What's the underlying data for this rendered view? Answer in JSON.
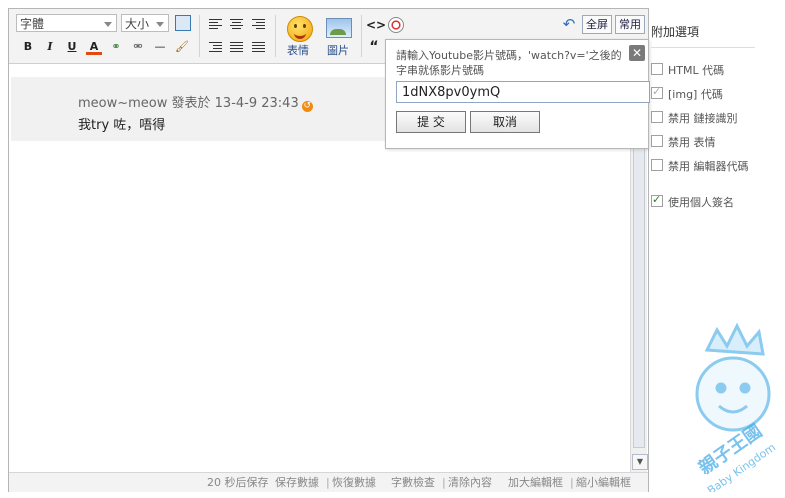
{
  "toolbar": {
    "font_select": "字體",
    "size_select": "大小",
    "emoticon_label": "表情",
    "image_label": "圖片",
    "fullscreen": "全屏",
    "common": "常用",
    "code_symbol": "<>",
    "quote_symbol": "“"
  },
  "post": {
    "author_line": "meow~meow 發表於 13-4-9 23:43",
    "message": "我try 咗，唔得"
  },
  "popup": {
    "prompt": "請輸入Youtube影片號碼，'watch?v='之後的字串就係影片號碼",
    "input_value": "1dNX8pv0ymQ",
    "submit": "提 交",
    "cancel": "取消",
    "close": "✕"
  },
  "sidebar": {
    "title": "附加選項",
    "options": [
      {
        "label": "HTML 代碼",
        "checked": false
      },
      {
        "label": "[img] 代碼",
        "checked": true
      },
      {
        "label": "禁用 鏈接識別",
        "checked": false
      },
      {
        "label": "禁用 表情",
        "checked": false
      },
      {
        "label": "禁用 編輯器代碼",
        "checked": false
      },
      {
        "label": "使用個人簽名",
        "checked": true
      }
    ]
  },
  "status": {
    "autosave": "20 秒后保存",
    "save": "保存數據",
    "restore": "恢復數據",
    "count": "字數檢查",
    "clear": "清除內容",
    "enlarge": "加大編輯框",
    "shrink": "縮小編輯框"
  },
  "watermark": {
    "line1": "親子王國",
    "line2": "Baby Kingdom"
  },
  "colors": {
    "accent": "#2a7a2a",
    "link": "#2a4f8a",
    "logo": "#3fa9e6"
  }
}
